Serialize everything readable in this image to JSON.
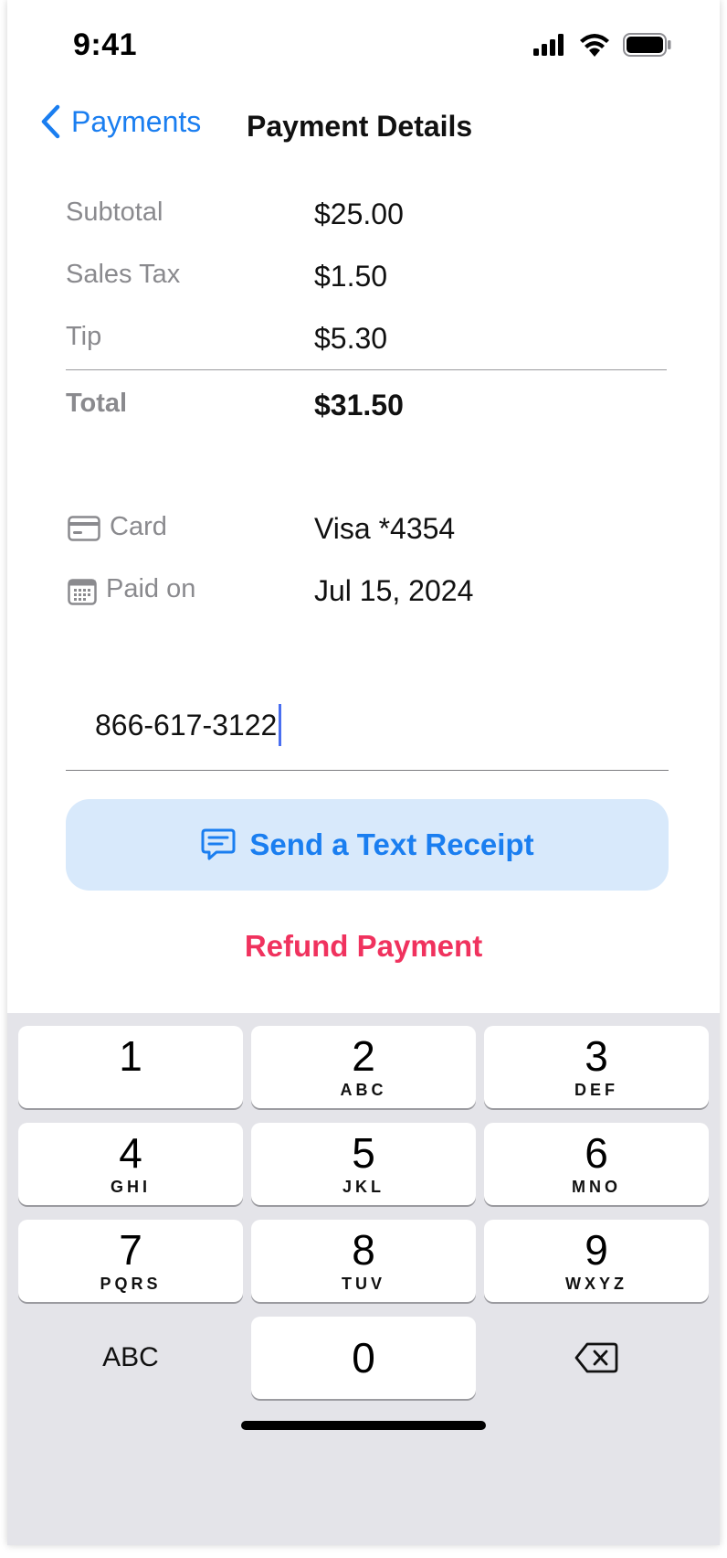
{
  "status_bar": {
    "time": "9:41"
  },
  "nav": {
    "back_label": "Payments",
    "title": "Payment Details"
  },
  "summary": {
    "rows": [
      {
        "label": "Subtotal",
        "value": "$25.00"
      },
      {
        "label": "Sales Tax",
        "value": "$1.50"
      },
      {
        "label": "Tip",
        "value": "$5.30"
      }
    ],
    "total": {
      "label": "Total",
      "value": "$31.50"
    }
  },
  "details": {
    "card": {
      "label": "Card",
      "value": "Visa *4354",
      "icon": "credit-card-icon"
    },
    "paid_on": {
      "label": "Paid on",
      "value": "Jul 15, 2024",
      "icon": "calendar-icon"
    }
  },
  "phone_input": {
    "value": "866-617-3122"
  },
  "actions": {
    "send_receipt_label": "Send a Text Receipt",
    "send_receipt_icon": "message-icon",
    "refund_label": "Refund Payment"
  },
  "keypad": {
    "keys": [
      {
        "digit": "1",
        "letters": ""
      },
      {
        "digit": "2",
        "letters": "ABC"
      },
      {
        "digit": "3",
        "letters": "DEF"
      },
      {
        "digit": "4",
        "letters": "GHI"
      },
      {
        "digit": "5",
        "letters": "JKL"
      },
      {
        "digit": "6",
        "letters": "MNO"
      },
      {
        "digit": "7",
        "letters": "PQRS"
      },
      {
        "digit": "8",
        "letters": "TUV"
      },
      {
        "digit": "9",
        "letters": "WXYZ"
      },
      {
        "digit": "0",
        "letters": ""
      }
    ],
    "abc_label": "ABC",
    "delete_icon": "backspace-icon"
  },
  "colors": {
    "accent": "#1a7ef0",
    "destructive": "#f0325e",
    "button_fill": "#d8e9fb",
    "keypad_bg": "#e4e4e9"
  }
}
